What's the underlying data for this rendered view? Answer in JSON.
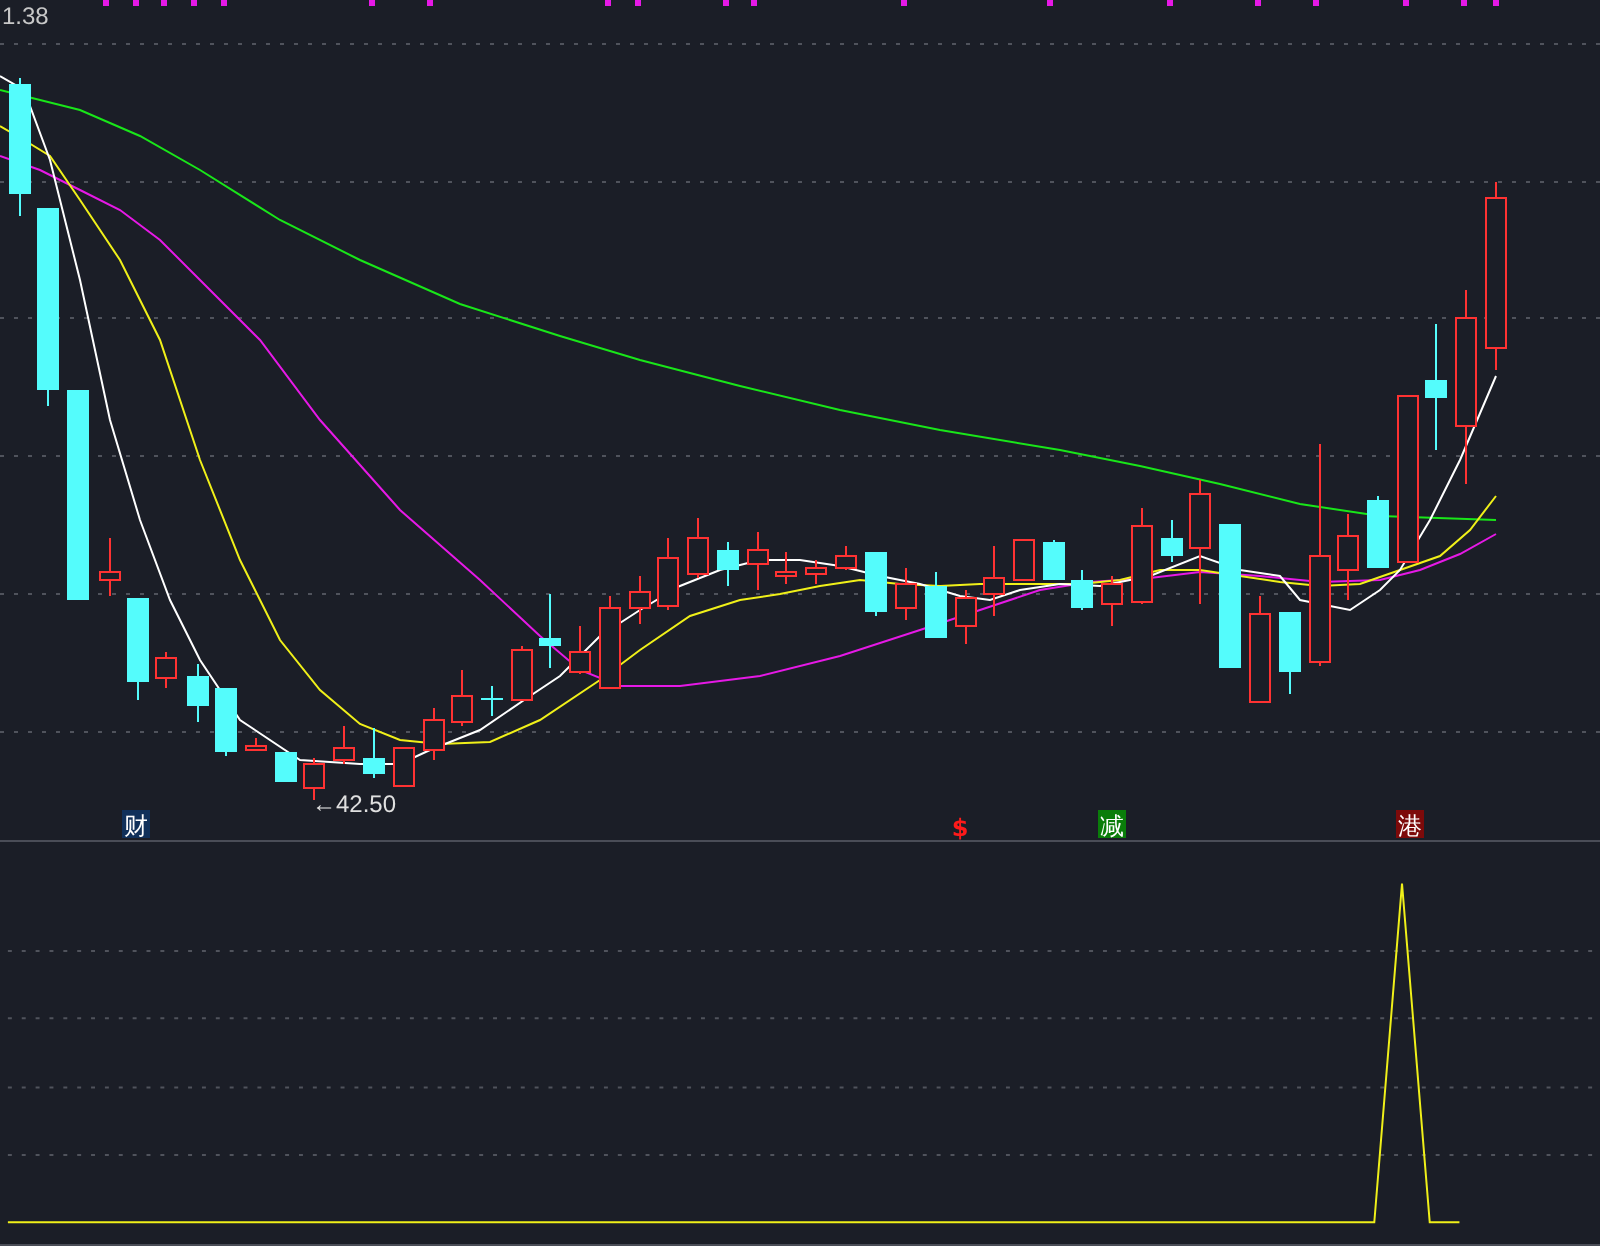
{
  "price_chart": {
    "top_price_label": "1.38",
    "low_price_label": "←42.50",
    "event_markers": [
      {
        "text": "财",
        "kind": "badge",
        "color": "#10305a"
      },
      {
        "text": "$",
        "kind": "plain",
        "color": "#ff1a1a"
      },
      {
        "text": "减",
        "kind": "badge",
        "color": "#0a7d0a"
      },
      {
        "text": "港",
        "kind": "badge",
        "color": "#7d0a0a"
      }
    ]
  }
}
